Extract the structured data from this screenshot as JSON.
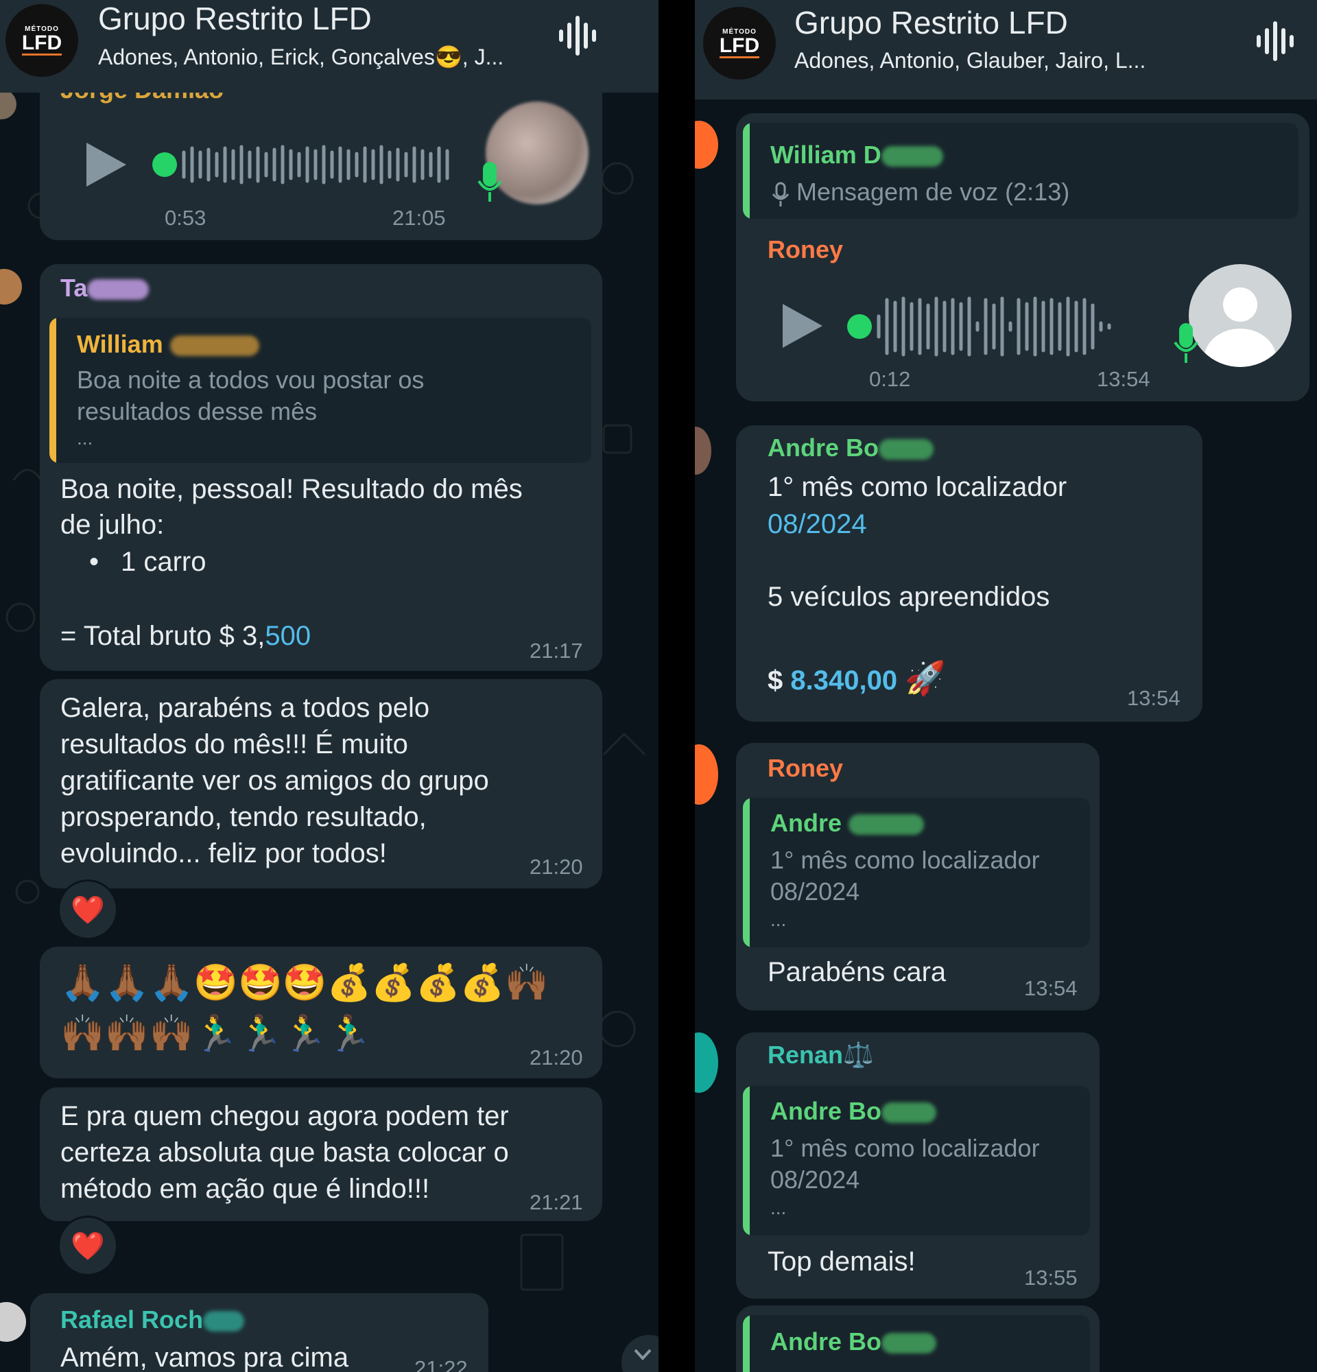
{
  "left": {
    "header": {
      "title": "Grupo Restrito LFD",
      "members": "Adones, Antonio, Erick, Gonçalves😎, J...",
      "logo_small": "MÉTODO",
      "logo_big": "LFD",
      "voice_icon": "audio-wave-icon"
    },
    "cut_sender": "Jorge Damião",
    "voice_message": {
      "duration": "0:53",
      "time": "21:05"
    },
    "msg1": {
      "sender": "Ta",
      "quote_sender": "William",
      "quote_line1": "Boa noite a todos vou postar os",
      "quote_line2": "resultados desse mês",
      "quote_more": "...",
      "line1": "Boa noite, pessoal! Resultado do mês",
      "line2": "de julho:",
      "bullet": "•",
      "item": "1 carro",
      "total_prefix": "= Total bruto $ 3,",
      "total_link": "500",
      "time": "21:17"
    },
    "msg2": {
      "line1": "Galera, parabéns a todos pelo",
      "line2": "resultados do mês!!! É muito",
      "line3": "gratificante ver os amigos do grupo",
      "line4": "prosperando, tendo resultado,",
      "line5": "evoluindo... feliz por todos!",
      "time": "21:20",
      "reaction": "❤️"
    },
    "msg3": {
      "line1": "🙏🏾🙏🏾🙏🏾🤩🤩🤩💰💰💰💰🙌🏾",
      "line2": "🙌🏾🙌🏾🙌🏾🏃‍♂️🏃‍♂️🏃‍♂️🏃‍♂️",
      "time": "21:20"
    },
    "msg4": {
      "line1": "E pra quem chegou agora podem ter",
      "line2": "certeza absoluta que basta colocar o",
      "line3": "método em ação que é lindo!!!",
      "time": "21:21",
      "reaction": "❤️"
    },
    "msg5": {
      "sender": "Rafael Roch",
      "text": "Amém, vamos pra cima",
      "time": "21:22"
    }
  },
  "right": {
    "header": {
      "title": "Grupo Restrito LFD",
      "members": "Adones, Antonio, Glauber, Jairo, L...",
      "logo_small": "MÉTODO",
      "logo_big": "LFD",
      "voice_icon": "audio-wave-icon"
    },
    "msg1": {
      "quote_sender": "William D",
      "quote_text": "Mensagem de voz (2:13)",
      "sender": "Roney",
      "duration": "0:12",
      "time": "13:54"
    },
    "msg2": {
      "sender": "Andre Bo",
      "line1": "1° mês como localizador",
      "line2": "08/2024",
      "line3": "5 veículos apreendidos",
      "money_prefix": "$ ",
      "money": "8.340,00",
      "emoji": "🚀",
      "time": "13:54"
    },
    "msg3": {
      "sender": "Roney",
      "quote_sender": "Andre",
      "quote_line1": "1° mês como localizador",
      "quote_line2": "08/2024",
      "quote_more": "...",
      "text": "Parabéns cara",
      "time": "13:54"
    },
    "msg4": {
      "sender": "Renan⚖️",
      "quote_sender": "Andre Bo",
      "quote_line1": "1° mês como localizador",
      "quote_line2": "08/2024",
      "quote_more": "...",
      "text": "Top demais!",
      "time": "13:55"
    },
    "msg5": {
      "quote_sender": "Andre Bo"
    }
  },
  "colors": {
    "chat_bg": "#0b141a",
    "bubble": "#1f2c34",
    "header": "#1f2c34",
    "green_accent": "#25d366",
    "link": "#53bdeb",
    "sender_purple": "#c9a5e8",
    "sender_gold": "#f0b43c",
    "sender_teal": "#3bc4b0",
    "sender_orange": "#ff7a45",
    "sender_green": "#5dd47a"
  }
}
